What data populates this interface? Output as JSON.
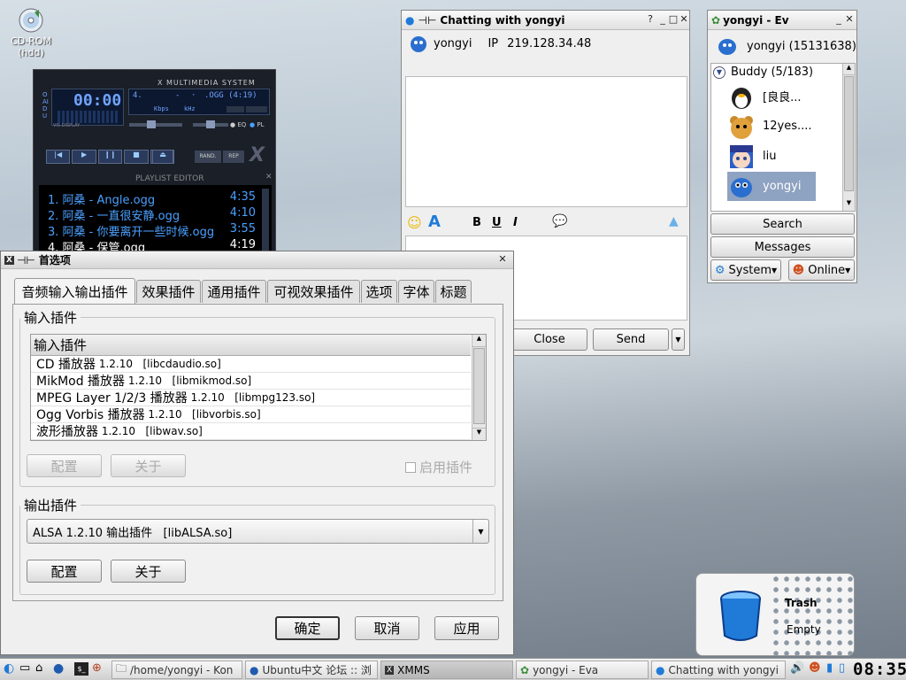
{
  "desktop": {
    "cdrom_label": "CD-ROM",
    "cdrom_sub": "(hdd)",
    "trash_title": "Trash",
    "trash_status": "Empty"
  },
  "xmms": {
    "title": "X MULTIMEDIA SYSTEM",
    "track_no": "4.",
    "dash": "-",
    "dot": "·",
    "format": ".OGG (4:19)",
    "kbps": "Kbps",
    "khz": "kHz",
    "eq": "EQ",
    "pl": "PL",
    "rand": "RAND.",
    "rep": "REP",
    "time": "00:00",
    "vis_label": "VIS DISPLAY",
    "side": "OAIDU",
    "playlist_title": "PLAYLIST EDITOR",
    "playlist": [
      {
        "title": "1. 阿桑 - Angle.ogg",
        "time": "4:35"
      },
      {
        "title": "2. 阿桑 - 一直很安静.ogg",
        "time": "4:10"
      },
      {
        "title": "3. 阿桑 - 你要离开一些时候.ogg",
        "time": "3:55"
      },
      {
        "title": "4. 阿桑 - 保管.ogg",
        "time": "4:19"
      }
    ]
  },
  "prefs": {
    "title": "首选项",
    "tabs": [
      "音频输入输出插件",
      "效果插件",
      "通用插件",
      "可视效果插件",
      "选项",
      "字体",
      "标题"
    ],
    "input_group": "输入插件",
    "list_header": "输入插件",
    "input_plugins": [
      {
        "name": "CD 播放器",
        "ver": "1.2.10",
        "lib": "[libcdaudio.so]"
      },
      {
        "name": "MikMod 播放器",
        "ver": "1.2.10",
        "lib": "[libmikmod.so]"
      },
      {
        "name": "MPEG Layer 1/2/3 播放器",
        "ver": "1.2.10",
        "lib": "[libmpg123.so]"
      },
      {
        "name": "Ogg Vorbis 播放器",
        "ver": "1.2.10",
        "lib": "[libvorbis.so]"
      },
      {
        "name": "波形播放器",
        "ver": "1.2.10",
        "lib": "[libwav.so]"
      }
    ],
    "configure": "配置",
    "about": "关于",
    "enable_plugin": "启用插件",
    "output_group": "输出插件",
    "output_value": "ALSA 1.2.10 输出插件   [libALSA.so]",
    "ok": "确定",
    "cancel": "取消",
    "apply": "应用"
  },
  "chat": {
    "title": "Chatting with yongyi",
    "user": "yongyi",
    "ip_label": "IP",
    "ip": "219.128.34.48",
    "close": "Close",
    "send": "Send"
  },
  "eva": {
    "title": "yongyi - Ev",
    "user": "yongyi (15131638)",
    "group": "Buddy (5/183)",
    "buddies": [
      "[良良...",
      "12yes....",
      "liu",
      "yongyi"
    ],
    "search": "Search",
    "messages": "Messages",
    "system": "System",
    "online": "Online"
  },
  "taskbar": {
    "tasks": [
      "/home/yongyi - Kon",
      "Ubuntu中文 论坛 :: 浏",
      "XMMS",
      "yongyi - Eva",
      "Chatting with yongyi"
    ],
    "clock": "08:35"
  },
  "colors": {
    "selection": "#8ea2c1",
    "xmms_text": "#4aa0ff",
    "accent_blue": "#1f7ad8"
  }
}
